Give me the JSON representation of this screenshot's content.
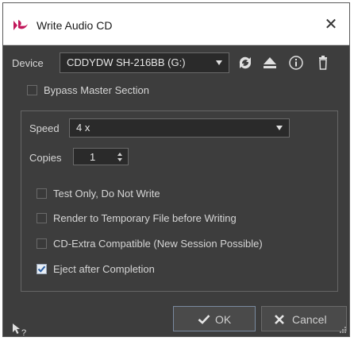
{
  "window": {
    "title": "Write Audio CD",
    "close_glyph": "✕"
  },
  "device": {
    "label": "Device",
    "selected": "CDDYDW SH-216BB (G:)",
    "icons": [
      "refresh-icon",
      "eject-icon",
      "info-icon",
      "trash-icon"
    ]
  },
  "bypass": {
    "label": "Bypass Master Section",
    "checked": false
  },
  "speed": {
    "label": "Speed",
    "selected": "4 x"
  },
  "copies": {
    "label": "Copies",
    "value": "1"
  },
  "options": [
    {
      "label": "Test Only, Do Not Write",
      "checked": false
    },
    {
      "label": "Render to Temporary File before Writing",
      "checked": false
    },
    {
      "label": "CD-Extra Compatible (New Session Possible)",
      "checked": false
    },
    {
      "label": "Eject after Completion",
      "checked": true
    }
  ],
  "buttons": {
    "ok_label": "OK",
    "cancel_label": "Cancel"
  },
  "colors": {
    "background": "#3d3d3d",
    "titlebar": "#ffffff",
    "logo": "#c2185b",
    "check_mark": "#2b5fa3"
  }
}
